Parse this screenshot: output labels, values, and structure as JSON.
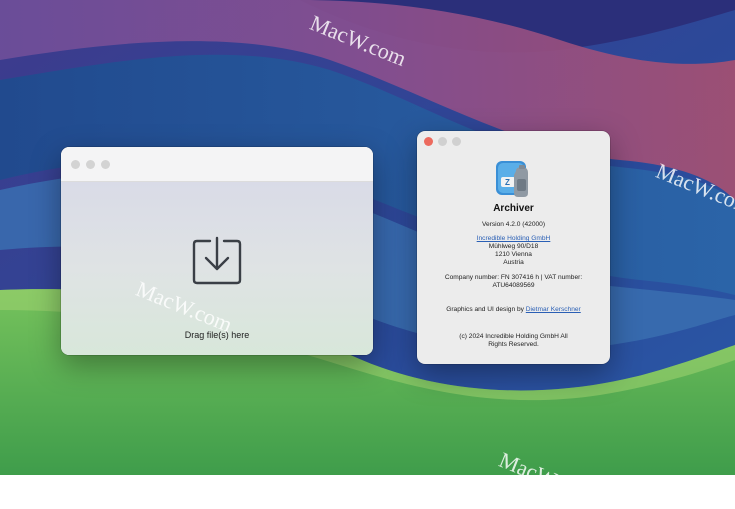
{
  "watermark": "MacW.com",
  "drop_window": {
    "drop_label": "Drag file(s) here"
  },
  "about": {
    "app_name": "Archiver",
    "version": "Version 4.2.0 (42000)",
    "company_link": "Incredible Holding GmbH",
    "address_line1": "Mühlweg 90/D18",
    "address_line2": "1210 Vienna",
    "address_line3": "Austria",
    "company_number_line1": "Company number: FN 307416 h | VAT number:",
    "company_number_line2": "ATU64089569",
    "design_prefix": "Graphics and UI design by",
    "designer_link": "Dietmar Kerschner",
    "copyright_line1": "(c) 2024 Incredible Holding GmbH All",
    "copyright_line2": "Rights Reserved."
  },
  "colors": {
    "close_button": "#ec6a5e",
    "link": "#2a5fb5",
    "wallpaper_green": "#5fbf57",
    "wallpaper_purple": "#5b3f8a"
  },
  "icons": {
    "drop_icon": "download-tray-icon",
    "app_icon": "archiver-app-icon"
  }
}
